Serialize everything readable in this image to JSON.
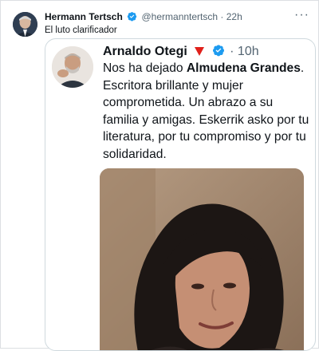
{
  "outer_tweet": {
    "author_name": "Hermann Tertsch",
    "handle": "@hermanntertsch",
    "separator": "·",
    "time": "22h",
    "text": "El luto clarificador",
    "more_icon": "more-horizontal-icon"
  },
  "quoted_screenshot": {
    "author_name": "Arnaldo Otegi",
    "separator": "·",
    "time": "10h",
    "text_before_bold": "Nos ha dejado ",
    "bold_name": "Almudena Grandes",
    "text_after_bold": ". Escritora brillante y mujer comprometida. Un abrazo a su familia y amigas. Eskerrik asko por tu literatura, por tu compromiso y por tu solidaridad.",
    "red_marker_icon": "red-triangle-icon",
    "photo": "portrait-photo"
  },
  "colors": {
    "verified_blue": "#1d9bf0",
    "text": "#0f1419",
    "secondary": "#536471",
    "red_triangle": "#e0201b"
  }
}
